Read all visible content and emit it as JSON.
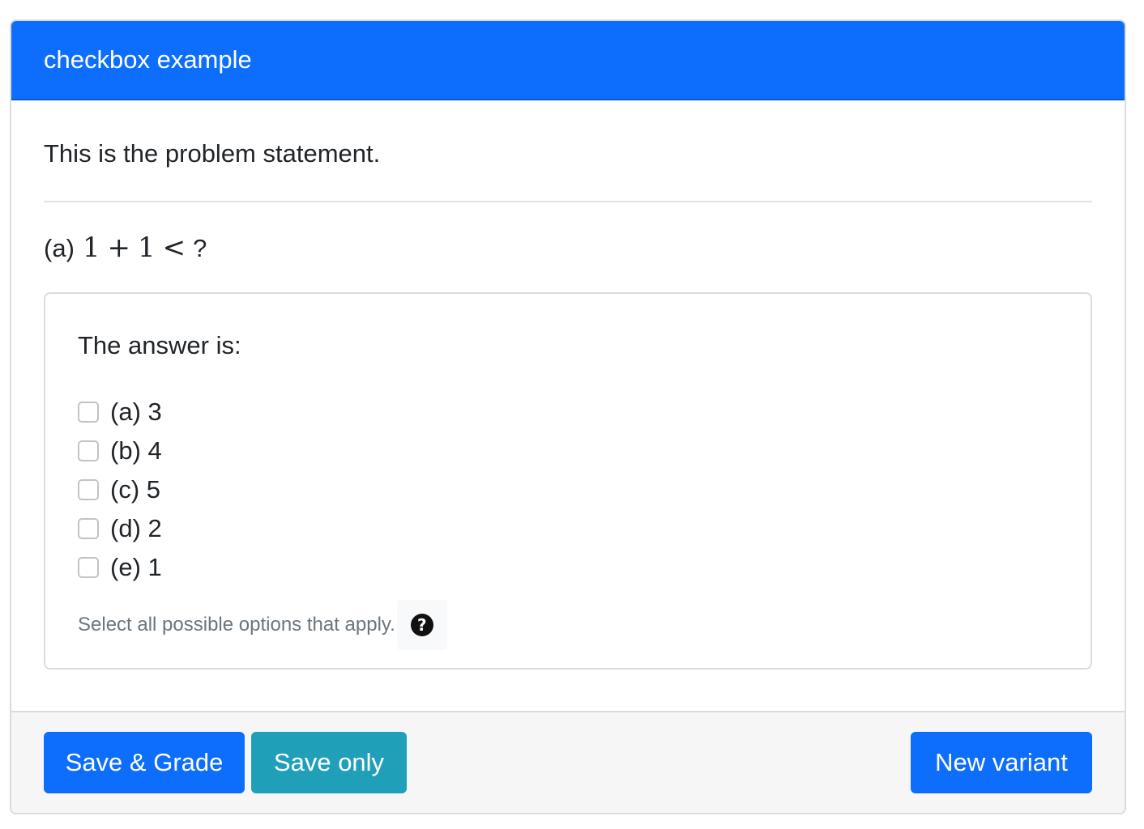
{
  "header": {
    "title": "checkbox example"
  },
  "body": {
    "statement": "This is the problem statement.",
    "question": {
      "label": "(a)",
      "math": {
        "lhs1": "1",
        "plus": "+",
        "lhs2": "1",
        "lt": "<",
        "rest": "?"
      }
    },
    "answer": {
      "title": "The answer is:",
      "options": [
        {
          "label": "(a) 3",
          "checked": false
        },
        {
          "label": "(b) 4",
          "checked": false
        },
        {
          "label": "(c) 5",
          "checked": false
        },
        {
          "label": "(d) 2",
          "checked": false
        },
        {
          "label": "(e) 1",
          "checked": false
        }
      ],
      "hint": "Select all possible options that apply.",
      "help_icon": "question-circle-icon"
    }
  },
  "footer": {
    "save_grade_label": "Save & Grade",
    "save_only_label": "Save only",
    "new_variant_label": "New variant"
  },
  "colors": {
    "primary": "#0d6efd",
    "info": "#20a0b8",
    "muted_text": "#6c757d"
  }
}
